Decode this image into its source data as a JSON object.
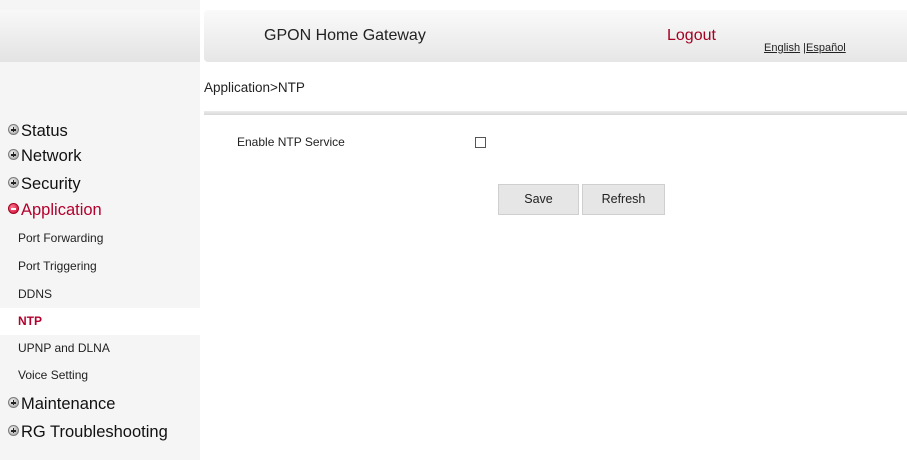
{
  "header": {
    "title": "GPON Home Gateway",
    "logout": "Logout",
    "lang_english": "English",
    "lang_separator": " |",
    "lang_spanish": "Español"
  },
  "breadcrumb": "Application>NTP",
  "sidebar": {
    "main_items": [
      {
        "label": "Status",
        "icon": "plus-circle-icon"
      },
      {
        "label": "Network",
        "icon": "plus-circle-icon"
      },
      {
        "label": "Security",
        "icon": "plus-circle-icon"
      },
      {
        "label": "Application",
        "icon": "minus-circle-icon",
        "expanded": true
      },
      {
        "label": "Maintenance",
        "icon": "plus-circle-icon"
      },
      {
        "label": "RG Troubleshooting",
        "icon": "plus-circle-icon"
      }
    ],
    "sub_items": [
      {
        "label": "Port Forwarding"
      },
      {
        "label": "Port Triggering"
      },
      {
        "label": "DDNS"
      },
      {
        "label": "NTP",
        "active": true
      },
      {
        "label": "UPNP and DLNA"
      },
      {
        "label": "Voice Setting"
      }
    ]
  },
  "form": {
    "enable_ntp_label": "Enable NTP Service",
    "enable_ntp_checked": false,
    "save_label": "Save",
    "refresh_label": "Refresh"
  },
  "colors": {
    "accent": "#b3002d",
    "sidebar_bg": "#f5f5f5",
    "button_bg": "#e6e6e6"
  }
}
